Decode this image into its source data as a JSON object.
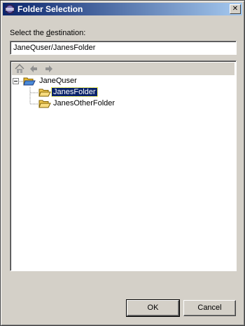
{
  "window": {
    "title": "Folder Selection",
    "close_glyph": "✕"
  },
  "prompt": {
    "text_before": "Select the ",
    "mnemonic": "d",
    "text_after": "estination:"
  },
  "path_input": {
    "value": "JaneQuser/JanesFolder"
  },
  "nav": {
    "icons": [
      "home-icon",
      "back-arrow-icon",
      "forward-arrow-icon"
    ]
  },
  "tree": {
    "root": {
      "label": "JaneQuser",
      "expanded": true
    },
    "children": [
      {
        "label": "JanesFolder",
        "selected": true
      },
      {
        "label": "JanesOtherFolder",
        "selected": false
      }
    ]
  },
  "buttons": {
    "ok": "OK",
    "cancel": "Cancel"
  },
  "colors": {
    "titlebar_start": "#0a246a",
    "titlebar_end": "#a6caf0",
    "selection": "#0a246a",
    "folder": "#f0c850"
  }
}
